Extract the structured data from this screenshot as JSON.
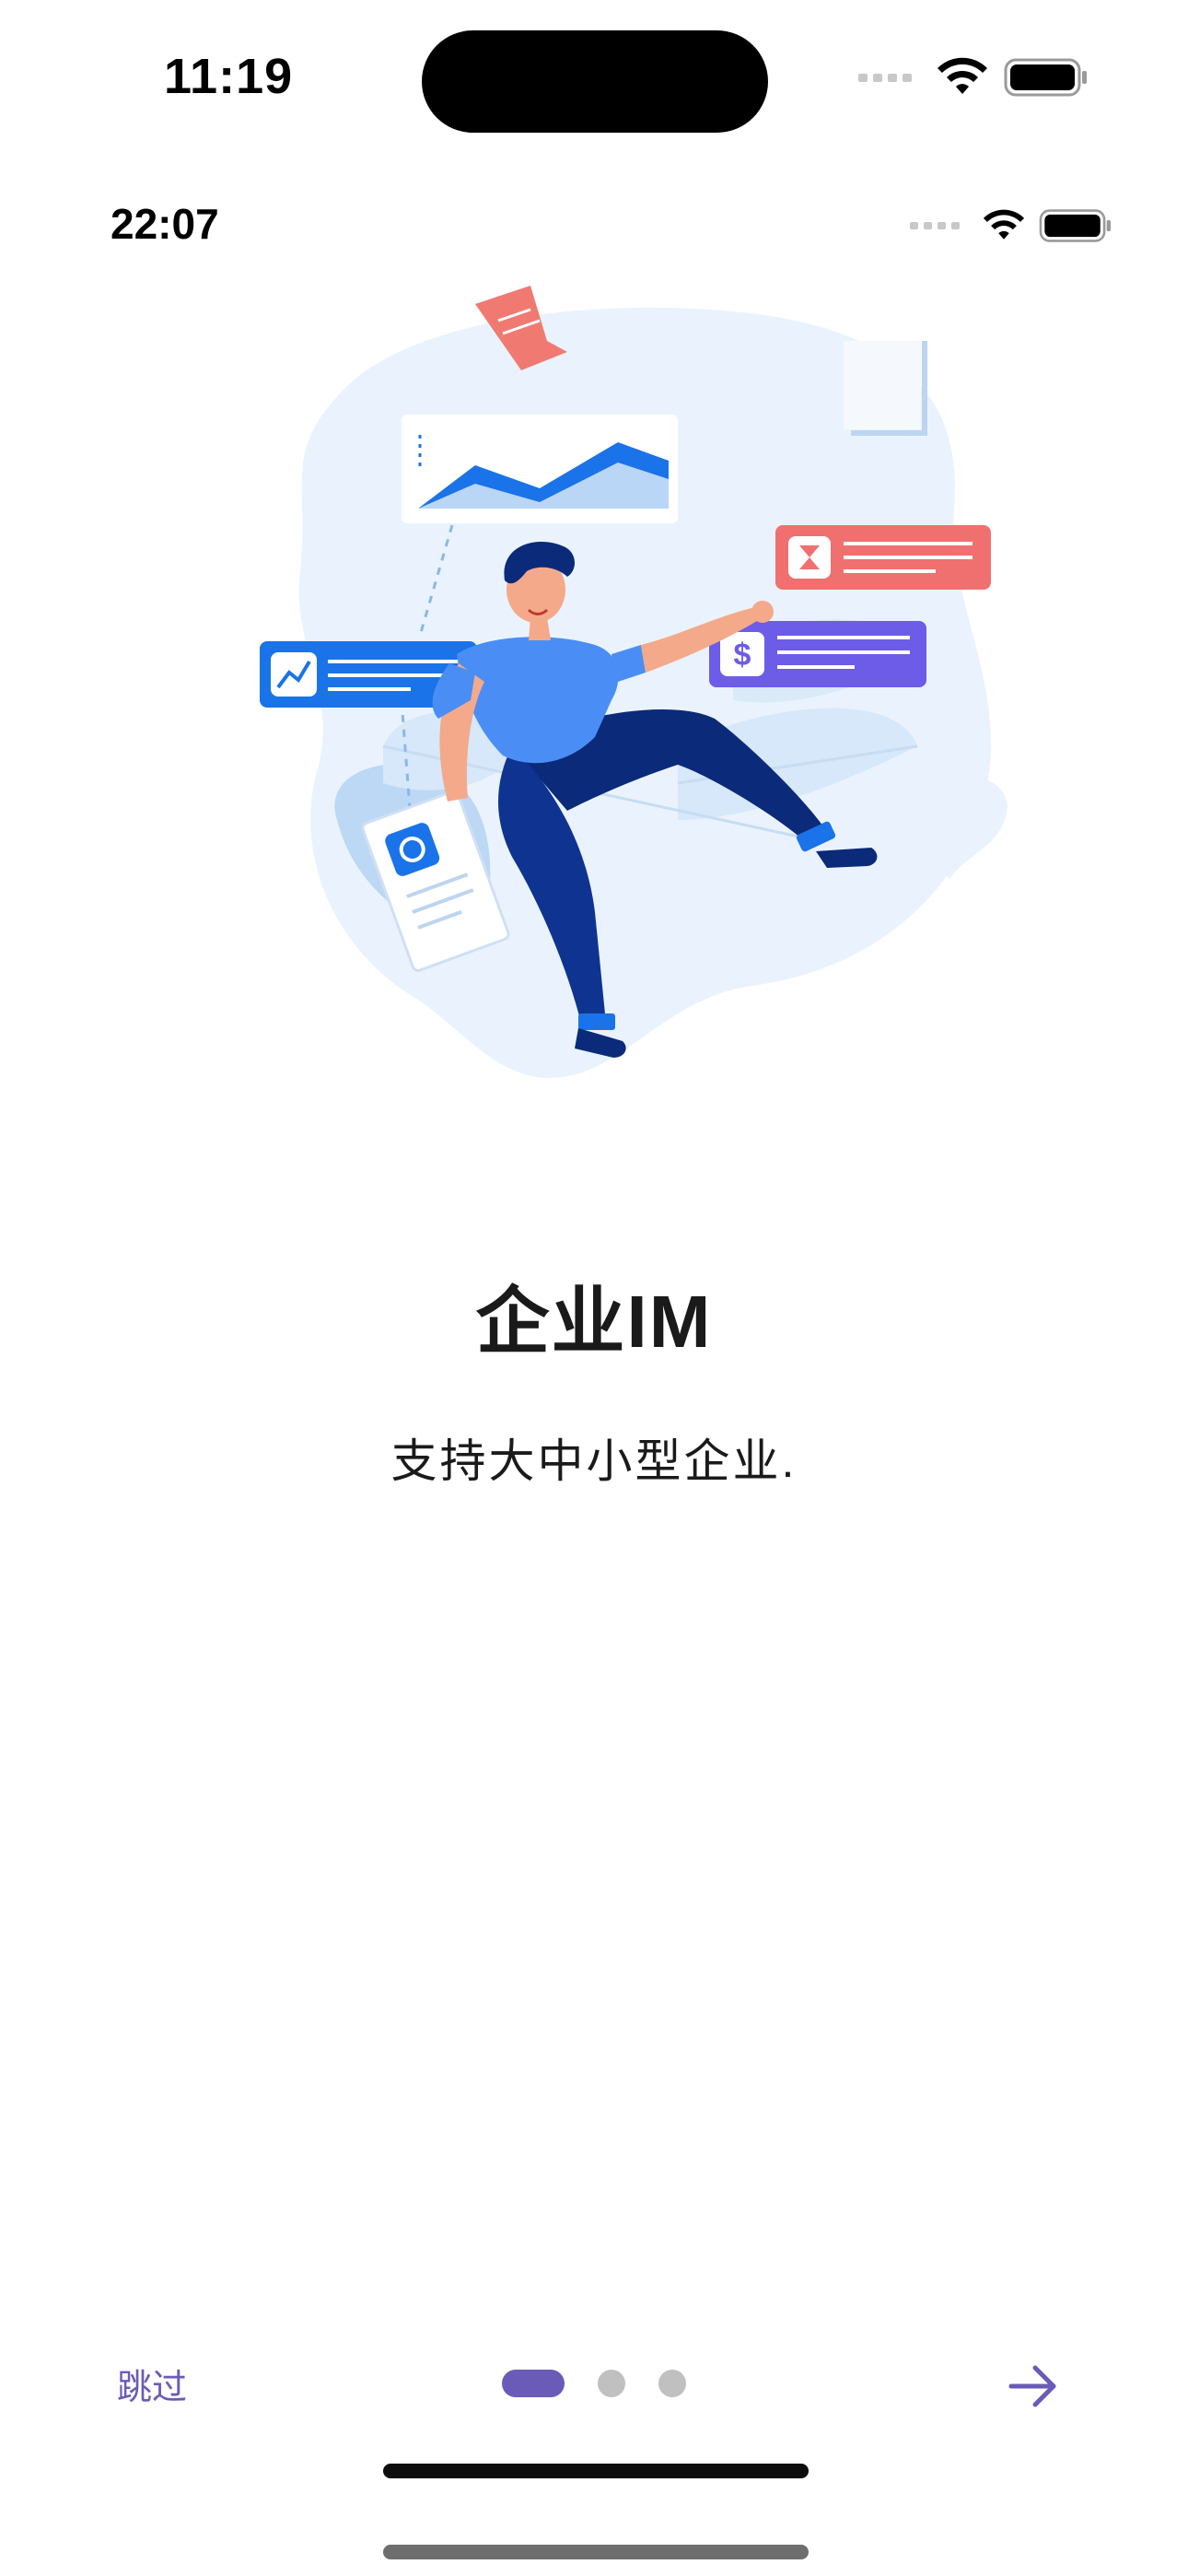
{
  "device_status": {
    "time": "11:19"
  },
  "app_status": {
    "time": "22:07"
  },
  "onboarding": {
    "title": "企业IM",
    "subtitle": "支持大中小型企业.",
    "skip_label": "跳过",
    "page_index": 1,
    "page_count": 3
  },
  "colors": {
    "accent": "#6a5bb8",
    "inactive_dot": "#c0c0c0",
    "illustration_blue": "#1a73e8",
    "illustration_navy": "#0b2a7a",
    "card_red": "#f07070",
    "card_purple": "#6c5ce7"
  },
  "icons": {
    "next": "arrow-right-icon",
    "wifi": "wifi-icon",
    "battery": "battery-icon"
  }
}
